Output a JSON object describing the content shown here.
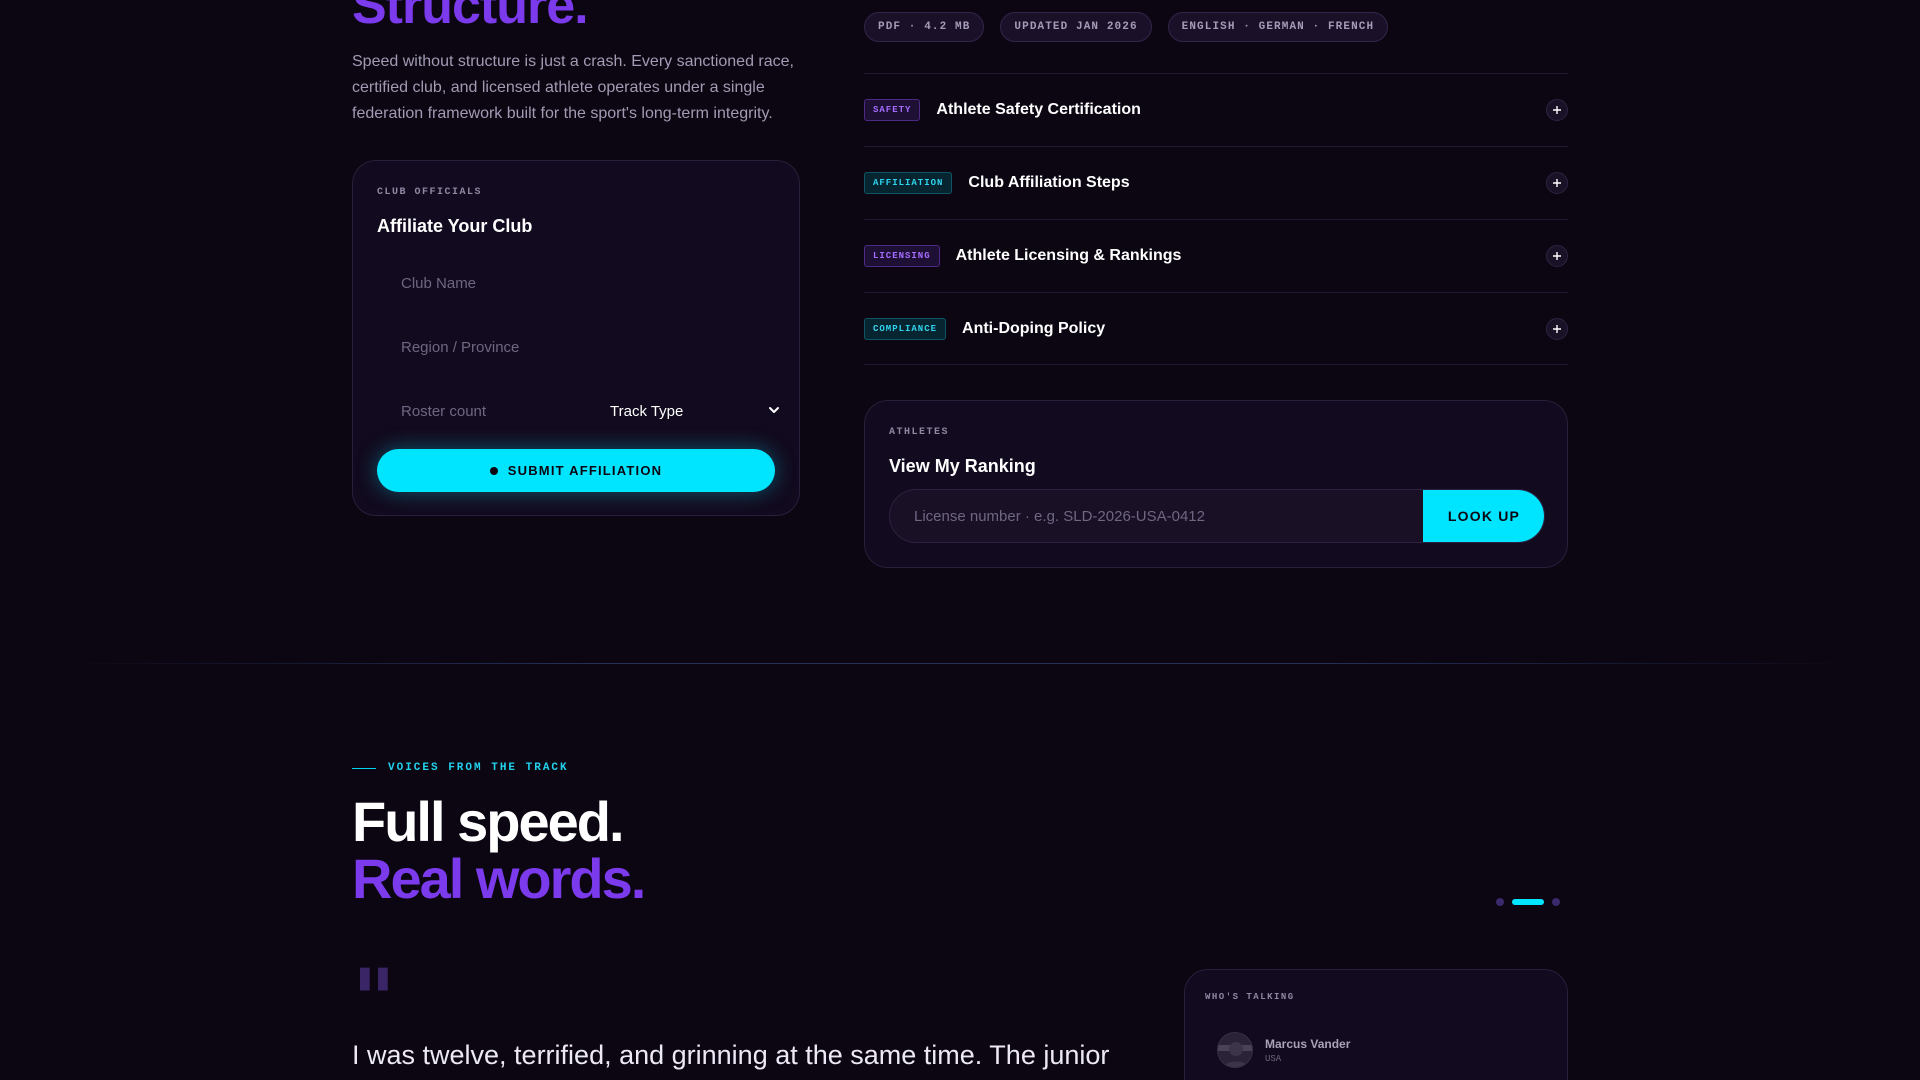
{
  "hero": {
    "title": "Structure.",
    "description": "Speed without structure is just a crash. Every sanctioned race, certified club, and licensed athlete operates under a single federation framework built for the sport's long-term integrity."
  },
  "affiliate": {
    "eyebrow": "CLUB OFFICIALS",
    "title": "Affiliate Your Club",
    "club_name_placeholder": "Club Name",
    "region_placeholder": "Region / Province",
    "roster_placeholder": "Roster count",
    "track_type": "Track Type",
    "submit_label": "SUBMIT AFFILIATION"
  },
  "document_meta": {
    "chips": [
      "PDF · 4.2 MB",
      "UPDATED JAN 2026",
      "ENGLISH · GERMAN · FRENCH"
    ]
  },
  "accordion": [
    {
      "tag": "SAFETY",
      "title": "Athlete Safety Certification",
      "tag_color": "#a56cff"
    },
    {
      "tag": "AFFILIATION",
      "title": "Club Affiliation Steps",
      "tag_color": "#2fd4ef"
    },
    {
      "tag": "LICENSING",
      "title": "Athlete Licensing & Rankings",
      "tag_color": "#a56cff"
    },
    {
      "tag": "COMPLIANCE",
      "title": "Anti-Doping Policy",
      "tag_color": "#2fd4ef"
    }
  ],
  "ranking": {
    "eyebrow": "ATHLETES",
    "title": "View My Ranking",
    "placeholder": "License number · e.g. SLD-2026-USA-0412",
    "button_label": "LOOK UP"
  },
  "voices": {
    "eyebrow": "VOICES FROM THE TRACK",
    "title_line1": "Full speed.",
    "title_line2": "Real words.",
    "quote_mark": "\"",
    "quote": "I was twelve, terrified, and grinning at the same time. The junior",
    "active_slide": 2,
    "slide_count": 3
  },
  "who": {
    "eyebrow": "WHO'S TALKING",
    "name": "Marcus Vander",
    "country": "USA"
  },
  "colors": {
    "background": "#0b0612",
    "accent_cyan": "#00e5ff",
    "accent_purple": "#7c3aed"
  }
}
